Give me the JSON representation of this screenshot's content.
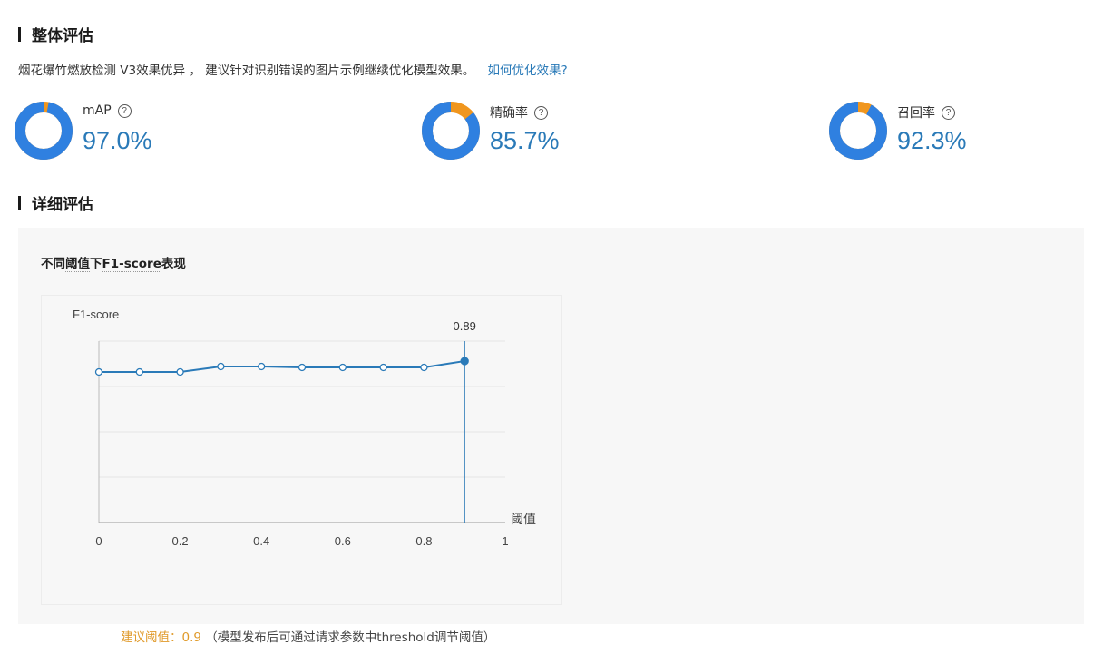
{
  "overall": {
    "title": "整体评估",
    "summary_text": "烟花爆竹燃放检测 V3效果优异 ， 建议针对识别错误的图片示例继续优化模型效果。",
    "optimize_link": "如何优化效果?",
    "metrics": [
      {
        "label": "mAP",
        "value_text": "97.0%",
        "value": 0.97
      },
      {
        "label": "精确率",
        "value_text": "85.7%",
        "value": 0.857
      },
      {
        "label": "召回率",
        "value_text": "92.3%",
        "value": 0.923
      }
    ],
    "help_icon": "question-circle-icon"
  },
  "detail": {
    "title": "详细评估",
    "chart_title_prefix": "不同",
    "chart_title_term1": "阈值",
    "chart_title_mid": "下",
    "chart_title_term2": "F1-score",
    "chart_title_suffix": "表现",
    "suggest_label": "建议阈值：0.9",
    "suggest_note": "（模型发布后可通过请求参数中threshold调节阈值）"
  },
  "colors": {
    "accent": "#2a7ab8",
    "donut_main": "#2f80e0",
    "donut_rest": "#f0961e",
    "line": "#2a7ab8",
    "highlight": "#e09a2a"
  },
  "chart_data": {
    "type": "line",
    "ylabel": "F1-score",
    "xlabel": "阈值",
    "x": [
      0,
      0.1,
      0.2,
      0.3,
      0.4,
      0.5,
      0.6,
      0.7,
      0.8,
      0.9
    ],
    "y": [
      0.83,
      0.83,
      0.83,
      0.86,
      0.86,
      0.855,
      0.855,
      0.855,
      0.855,
      0.89
    ],
    "xlim": [
      0,
      1
    ],
    "x_ticks": [
      "0",
      "0.2",
      "0.4",
      "0.6",
      "0.8",
      "1"
    ],
    "ylim": [
      0,
      1
    ],
    "highlight_x": 0.9,
    "highlight_label": "0.89",
    "grid": true
  }
}
